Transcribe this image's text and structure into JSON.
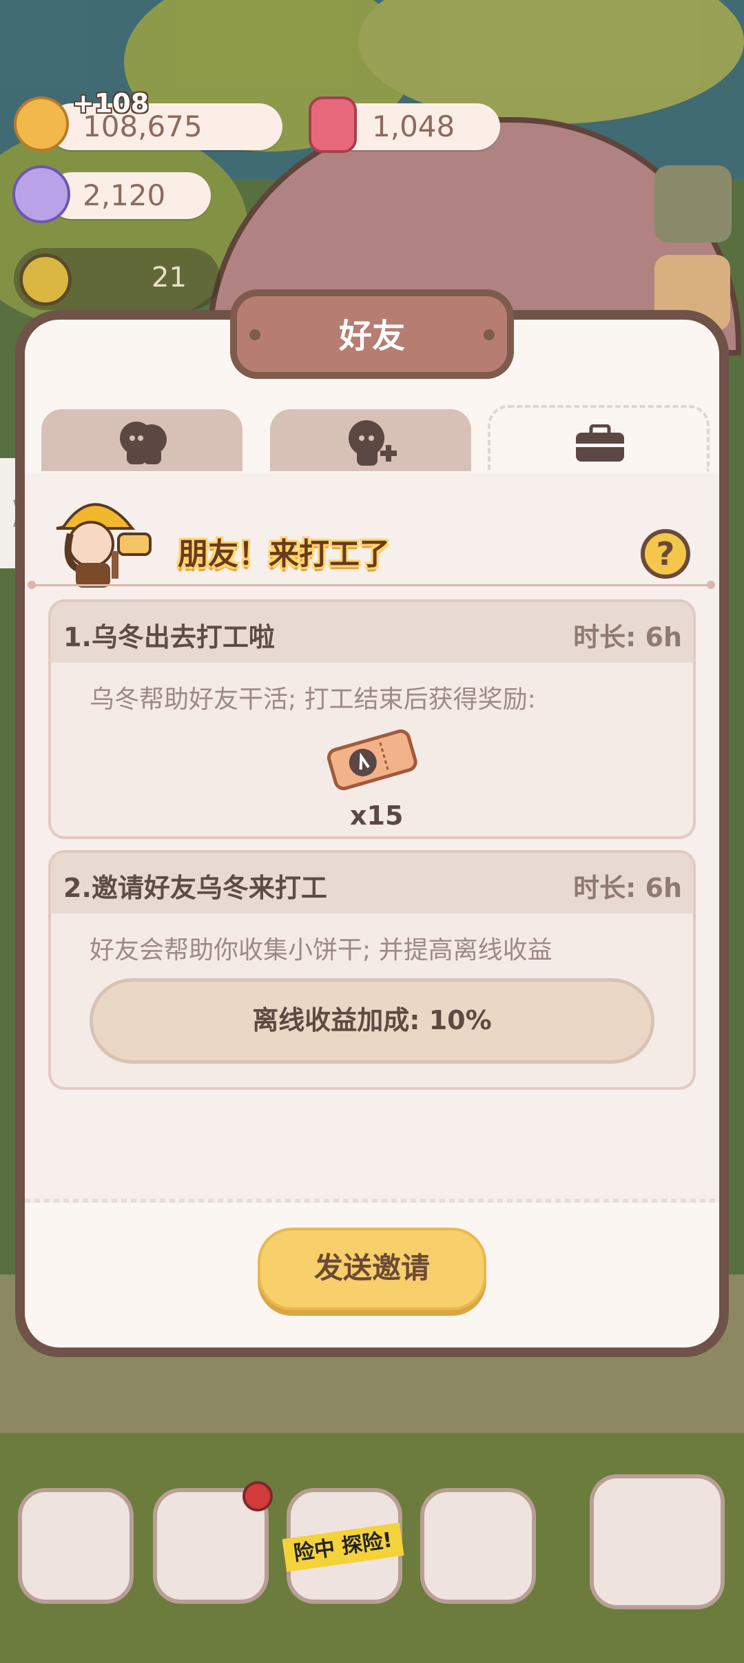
{
  "hud": {
    "cookies": "108,675",
    "cookies_gain": "+108",
    "candles": "1,048",
    "gems": "2,120",
    "level_count": "21"
  },
  "modal": {
    "title": "好友",
    "tabs": [
      {
        "icon": "friends-icon",
        "active": false
      },
      {
        "icon": "add-friend-icon",
        "active": false
      },
      {
        "icon": "briefcase-icon",
        "active": true
      }
    ],
    "banner": "朋友！来打工了",
    "help": "?",
    "cards": [
      {
        "title": "1.乌冬出去打工啦",
        "duration": "时长: 6h",
        "desc": "乌冬帮助好友干活; 打工结束后获得奖励:",
        "reward_icon": "ticket-icon",
        "reward_qty": "x15"
      },
      {
        "title": "2.邀请好友乌冬来打工",
        "duration": "时长: 6h",
        "desc": "好友会帮助你收集小饼干; 并提高离线收益",
        "bonus": "离线收益加成: 10%"
      }
    ],
    "send_button": "发送邀请"
  },
  "edge_tab": "⟩",
  "nav": {
    "expedition_tape": "险中 探险!"
  },
  "colors": {
    "modal_border": "#6f5248",
    "modal_bg": "#fbf6f2",
    "send_button": "#f7cf6b",
    "title_plaque": "#b67e72"
  }
}
